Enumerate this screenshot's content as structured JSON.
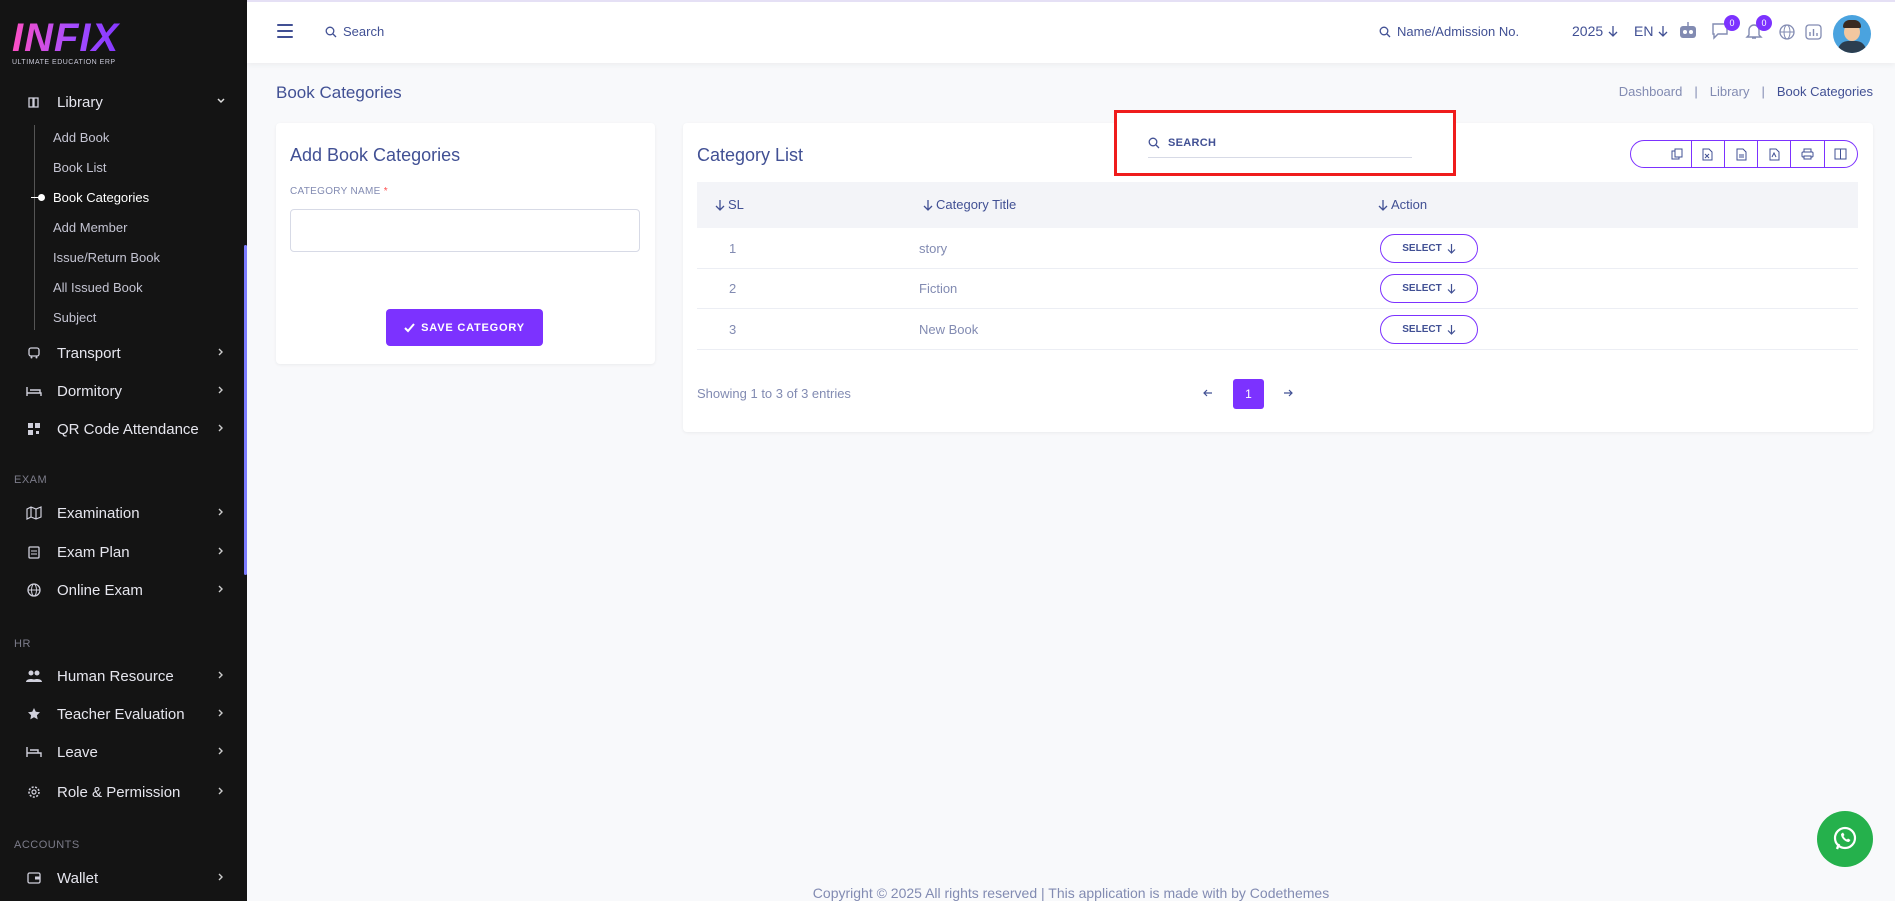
{
  "sidebar": {
    "logo_text": "INFIX",
    "logo_tagline": "ULTIMATE EDUCATION ERP",
    "library": {
      "label": "Library",
      "chevron": "⌄"
    },
    "library_sub": [
      "Add Book",
      "Book List",
      "Book Categories",
      "Add Member",
      "Issue/Return Book",
      "All Issued Book",
      "Subject"
    ],
    "items": [
      {
        "label": "Transport",
        "icon": "bus-icon"
      },
      {
        "label": "Dormitory",
        "icon": "bed-icon"
      },
      {
        "label": "QR Code Attendance",
        "icon": "qr-icon"
      }
    ],
    "sections": {
      "exam": "EXAM",
      "hr": "HR",
      "accounts": "ACCOUNTS"
    },
    "exam_items": [
      "Examination",
      "Exam Plan",
      "Online Exam"
    ],
    "hr_items": [
      "Human Resource",
      "Teacher Evaluation",
      "Leave",
      "Role & Permission"
    ],
    "accounts_items": [
      "Wallet"
    ]
  },
  "topbar": {
    "search_label": "Search",
    "student_search_label": "Name/Admission No.",
    "year": "2025",
    "language": "EN",
    "messages_count": "0",
    "notifications_count": "0"
  },
  "page": {
    "title": "Book Categories",
    "breadcrumb": [
      "Dashboard",
      "Library",
      "Book Categories"
    ],
    "breadcrumb_sep": "|"
  },
  "form": {
    "title": "Add Book Categories",
    "field_label": "CATEGORY NAME",
    "required_mark": "*",
    "save_label": "SAVE CATEGORY"
  },
  "list": {
    "title": "Category List",
    "search_placeholder": "SEARCH",
    "columns": [
      "SL",
      "Category Title",
      "Action"
    ],
    "rows": [
      {
        "sl": "1",
        "title": "story",
        "action": "SELECT"
      },
      {
        "sl": "2",
        "title": "Fiction",
        "action": "SELECT"
      },
      {
        "sl": "3",
        "title": "New Book",
        "action": "SELECT"
      }
    ],
    "showing": "Showing 1 to 3 of 3 entries",
    "current_page": "1"
  },
  "footer": {
    "text": "Copyright © 2025 All rights reserved | This application is made with by Codethemes"
  },
  "colors": {
    "accent": "#7c32ff",
    "highlight_box": "#ef1c1c",
    "sidebar_bg": "#141414",
    "whatsapp": "#25b14c"
  }
}
